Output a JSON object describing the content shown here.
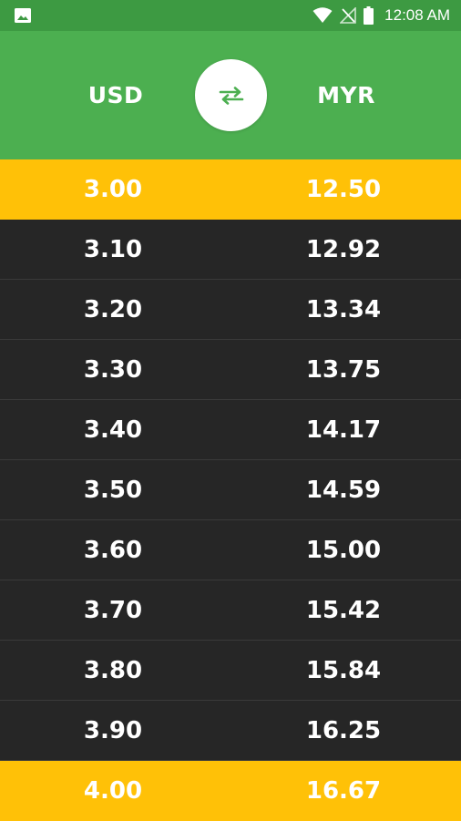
{
  "status_bar": {
    "time": "12:08 AM",
    "icons": [
      "gallery-icon",
      "wifi-icon",
      "no-signal-icon",
      "battery-icon"
    ]
  },
  "header": {
    "from_currency": "USD",
    "to_currency": "MYR",
    "swap_icon": "swap-arrows-icon"
  },
  "colors": {
    "status_bar": "#3d9a42",
    "header": "#4caf50",
    "highlight": "#ffc107",
    "row_background": "#262626",
    "swap_icon": "#4caf50"
  },
  "rows": [
    {
      "usd": "3.00",
      "myr": "12.50",
      "highlight": true
    },
    {
      "usd": "3.10",
      "myr": "12.92",
      "highlight": false
    },
    {
      "usd": "3.20",
      "myr": "13.34",
      "highlight": false
    },
    {
      "usd": "3.30",
      "myr": "13.75",
      "highlight": false
    },
    {
      "usd": "3.40",
      "myr": "14.17",
      "highlight": false
    },
    {
      "usd": "3.50",
      "myr": "14.59",
      "highlight": false
    },
    {
      "usd": "3.60",
      "myr": "15.00",
      "highlight": false
    },
    {
      "usd": "3.70",
      "myr": "15.42",
      "highlight": false
    },
    {
      "usd": "3.80",
      "myr": "15.84",
      "highlight": false
    },
    {
      "usd": "3.90",
      "myr": "16.25",
      "highlight": false
    },
    {
      "usd": "4.00",
      "myr": "16.67",
      "highlight": true
    }
  ]
}
